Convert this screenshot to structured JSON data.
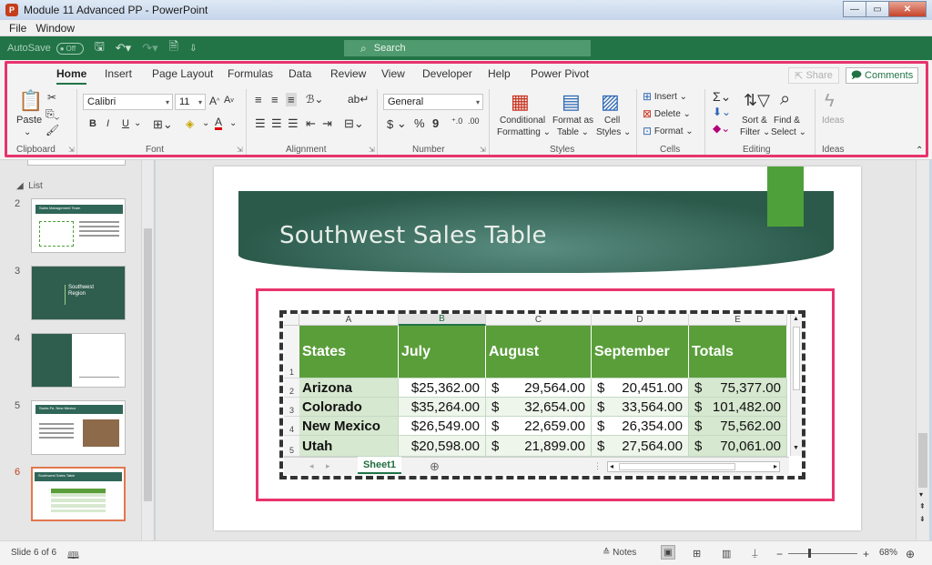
{
  "window": {
    "title": "Module 11 Advanced PP - PowerPoint",
    "app_badge": "P",
    "min": "—",
    "max": "▭",
    "close": "✕"
  },
  "menubar": {
    "file": "File",
    "window": "Window"
  },
  "quick_access": {
    "autosave": "AutoSave",
    "autosave_state": "Off",
    "search_placeholder": "Search"
  },
  "ribbon": {
    "tabs": [
      "Home",
      "Insert",
      "Page Layout",
      "Formulas",
      "Data",
      "Review",
      "View",
      "Developer",
      "Help",
      "Power Pivot"
    ],
    "share": "Share",
    "comments": "Comments",
    "clipboard": {
      "paste": "Paste",
      "label": "Clipboard"
    },
    "font": {
      "name": "Calibri",
      "size": "11",
      "bold": "B",
      "italic": "I",
      "underline": "U",
      "label": "Font"
    },
    "alignment": {
      "label": "Alignment"
    },
    "number": {
      "format": "General",
      "currency": "$",
      "percent": "%",
      "comma": "9",
      "label": "Number"
    },
    "styles": {
      "conditional": "Conditional",
      "conditional2": "Formatting",
      "format_table": "Format as",
      "format_table2": "Table",
      "cell_styles": "Cell",
      "cell_styles2": "Styles",
      "label": "Styles"
    },
    "cells": {
      "insert": "Insert",
      "delete": "Delete",
      "format": "Format",
      "label": "Cells"
    },
    "editing": {
      "sort": "Sort &",
      "sort2": "Filter",
      "find": "Find &",
      "find2": "Select",
      "label": "Editing"
    },
    "ideas": {
      "button": "Ideas",
      "label": "Ideas"
    }
  },
  "slides_panel": {
    "section": "List",
    "slides": [
      {
        "num": "2",
        "title": "Sales Management Team"
      },
      {
        "num": "3",
        "title": "Southwest Region"
      },
      {
        "num": "4",
        "title": ""
      },
      {
        "num": "5",
        "title": "Santa Fe, New Mexico"
      },
      {
        "num": "6",
        "title": "Southwest Sales Table"
      }
    ]
  },
  "slide": {
    "title": "Southwest Sales Table",
    "table": {
      "col_letters": [
        "A",
        "B",
        "C",
        "D",
        "E"
      ],
      "row_numbers": [
        "1",
        "2",
        "3",
        "4",
        "5"
      ],
      "headers": [
        "States",
        "July",
        "August",
        "September",
        "Totals"
      ],
      "rows": [
        {
          "state": "Arizona",
          "july": "$25,362.00",
          "aug_sym": "$",
          "aug": "29,564.00",
          "sep_sym": "$",
          "sep": "20,451.00",
          "tot_sym": "$",
          "tot": "75,377.00"
        },
        {
          "state": "Colorado",
          "july": "$35,264.00",
          "aug_sym": "$",
          "aug": "32,654.00",
          "sep_sym": "$",
          "sep": "33,564.00",
          "tot_sym": "$",
          "tot": "101,482.00"
        },
        {
          "state": "New Mexico",
          "july": "$26,549.00",
          "aug_sym": "$",
          "aug": "22,659.00",
          "sep_sym": "$",
          "sep": "26,354.00",
          "tot_sym": "$",
          "tot": "75,562.00"
        },
        {
          "state": "Utah",
          "july": "$20,598.00",
          "aug_sym": "$",
          "aug": "21,899.00",
          "sep_sym": "$",
          "sep": "27,564.00",
          "tot_sym": "$",
          "tot": "70,061.00"
        }
      ],
      "sheet_tab": "Sheet1",
      "add_sheet": "⊕"
    }
  },
  "statusbar": {
    "slide_info": "Slide 6 of 6",
    "notes": "Notes",
    "zoom": "68%",
    "minus": "−",
    "plus": "+"
  },
  "colors": {
    "accent_green": "#217346",
    "highlight": "#e8336d",
    "header_green": "#5a9e3a"
  }
}
